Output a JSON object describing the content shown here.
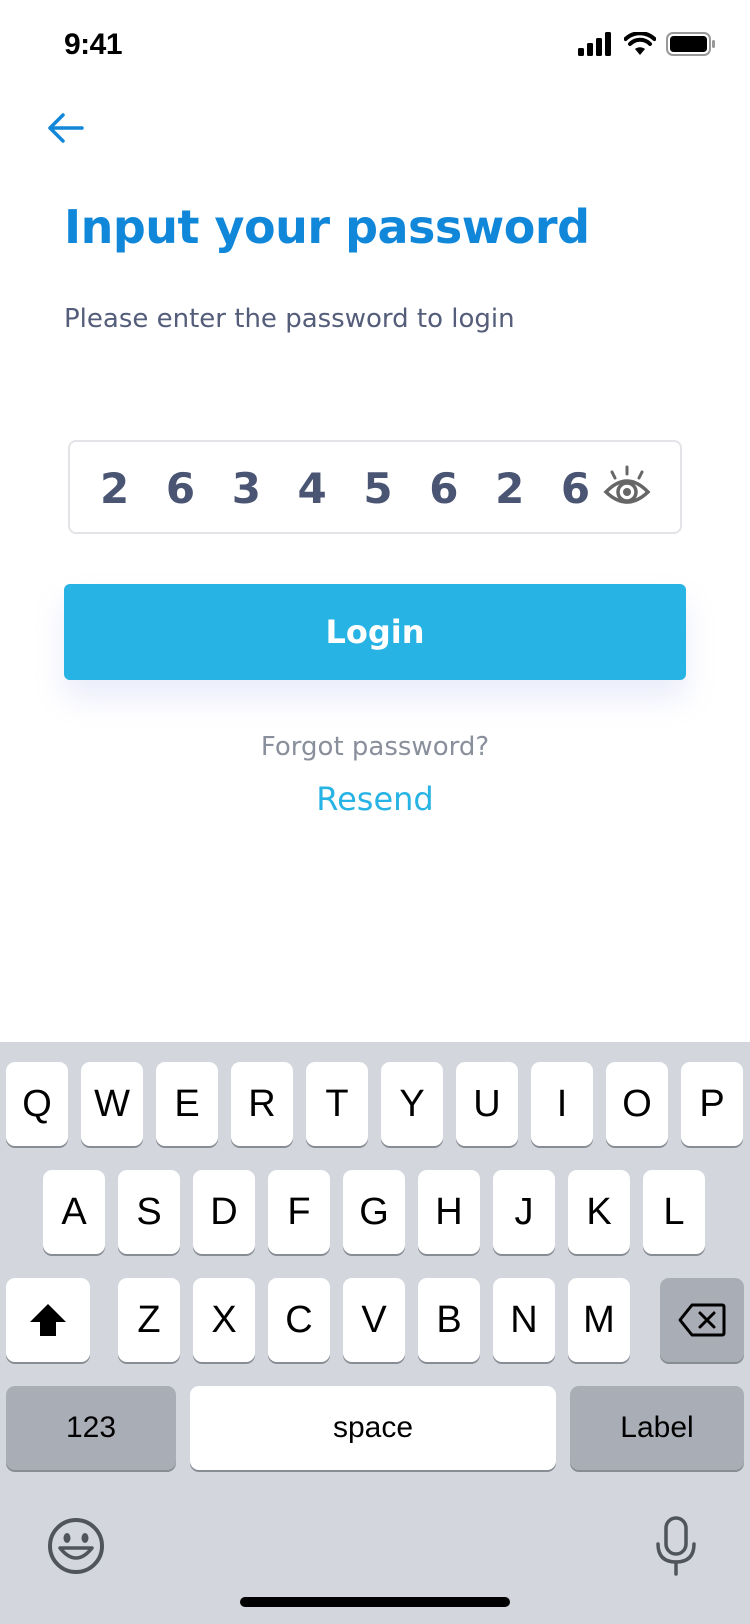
{
  "status_bar": {
    "time": "9:41"
  },
  "title": "Input your password",
  "subtitle": "Please enter the password to login",
  "password_field": {
    "value": "2 6 3 4 5 6 2 6"
  },
  "login_button": {
    "label": "Login"
  },
  "forgot": {
    "text": "Forgot password?",
    "resend": "Resend"
  },
  "keyboard": {
    "row1": [
      "Q",
      "W",
      "E",
      "R",
      "T",
      "Y",
      "U",
      "I",
      "O",
      "P"
    ],
    "row2": [
      "A",
      "S",
      "D",
      "F",
      "G",
      "H",
      "J",
      "K",
      "L"
    ],
    "row3": [
      "Z",
      "X",
      "C",
      "V",
      "B",
      "N",
      "M"
    ],
    "numbers_label": "123",
    "space_label": "space",
    "return_label": "Label"
  },
  "colors": {
    "accent_blue": "#1087d9",
    "button": "#27b3e3",
    "keyboard_bg": "#d3d6dc"
  },
  "icons": [
    "back-arrow-icon",
    "signal-icon",
    "wifi-icon",
    "battery-icon",
    "eye-icon",
    "shift-icon",
    "backspace-icon",
    "emoji-icon",
    "microphone-icon"
  ]
}
